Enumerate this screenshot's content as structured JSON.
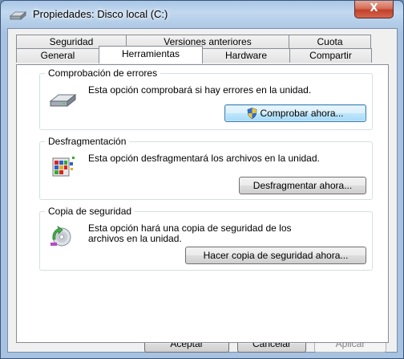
{
  "window": {
    "title": "Propiedades: Disco local (C:)",
    "close_label": "X"
  },
  "tabs": {
    "row_top": [
      "Seguridad",
      "Versiones anteriores",
      "Cuota"
    ],
    "row_bottom": [
      "General",
      "Herramientas",
      "Hardware",
      "Compartir"
    ],
    "active": "Herramientas"
  },
  "groups": {
    "check": {
      "title": "Comprobación de errores",
      "description": "Esta opción comprobará si hay errores en la unidad.",
      "button": "Comprobar ahora...",
      "icon": "hard-drive-icon"
    },
    "defrag": {
      "title": "Desfragmentación",
      "description": "Esta opción desfragmentará los archivos en la unidad.",
      "button": "Desfragmentar ahora...",
      "icon": "defrag-icon"
    },
    "backup": {
      "title": "Copia de seguridad",
      "description": "Esta opción hará una copia de seguridad de los archivos en la unidad.",
      "button": "Hacer copia de seguridad ahora...",
      "icon": "backup-icon"
    }
  },
  "footer": {
    "ok": "Aceptar",
    "cancel": "Cancelar",
    "apply": "Aplicar"
  }
}
